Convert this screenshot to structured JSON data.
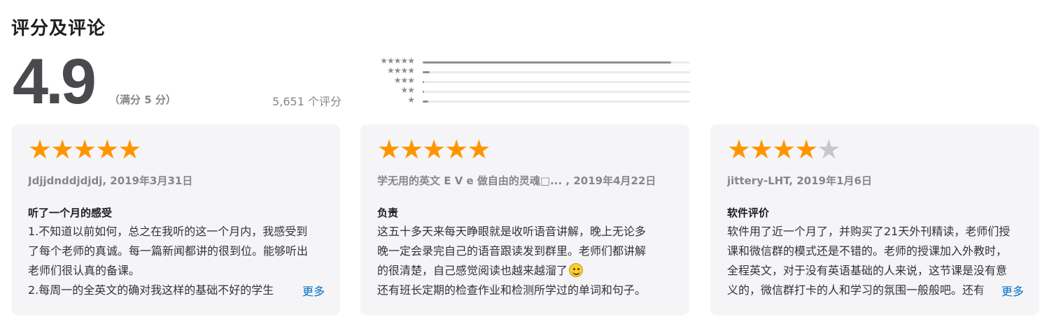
{
  "section": {
    "title": "评分及评论"
  },
  "summary": {
    "score": "4.9",
    "out_of": "（满分 5 分）",
    "count": "5,651 个评分"
  },
  "histogram": [
    {
      "stars": "★★★★★",
      "fraction": 0.93
    },
    {
      "stars": "★★★★",
      "fraction": 0.025
    },
    {
      "stars": "★★★",
      "fraction": 0.004
    },
    {
      "stars": "★★",
      "fraction": 0.004
    },
    {
      "stars": "★",
      "fraction": 0.02
    }
  ],
  "colors": {
    "star": "#ff9500",
    "star_empty": "#c7c7cc",
    "link": "#0070c9",
    "card_bg": "#f5f5f7"
  },
  "reviews": [
    {
      "rating": 5,
      "meta": "Jdjjdnddjdjdj, 2019年3月31日",
      "title": "听了一个月的感受",
      "body": [
        "1.不知道以前如何，总之在我听的这一个月内，我感受到",
        "了每个老师的真诚。每一篇新闻都讲的很到位。能够听出",
        "老师们很认真的备课。",
        "2.每周一的全英文的确对我这样的基础不好的学生"
      ],
      "more": "更多"
    },
    {
      "rating": 5,
      "meta": "学无用的英文 E V e 做自由的灵魂□... , 2019年4月22日",
      "title": "负责",
      "body": [
        "这五十多天来每天睁眼就是收听语音讲解，晚上无论多",
        "晚一定会录完自己的语音跟读发到群里。老师们都讲解",
        "的很清楚，自己感觉阅读也越来越溜了",
        "还有班长定期的检查作业和检测所学过的单词和句子。"
      ],
      "more": ""
    },
    {
      "rating": 4,
      "meta": "jittery-LHT, 2019年1月6日",
      "title": "软件评价",
      "body": [
        "软件用了近一个月了，并购买了21天外刊精读，老师们授",
        "课和微信群的模式还是不错的。老师的授课加入外教时，",
        "全程英文，对于没有英语基础的人来说，这节课是没有意",
        "义的，微信群打卡的人和学习的氛围一般般吧。还有"
      ],
      "more": "更多"
    }
  ]
}
